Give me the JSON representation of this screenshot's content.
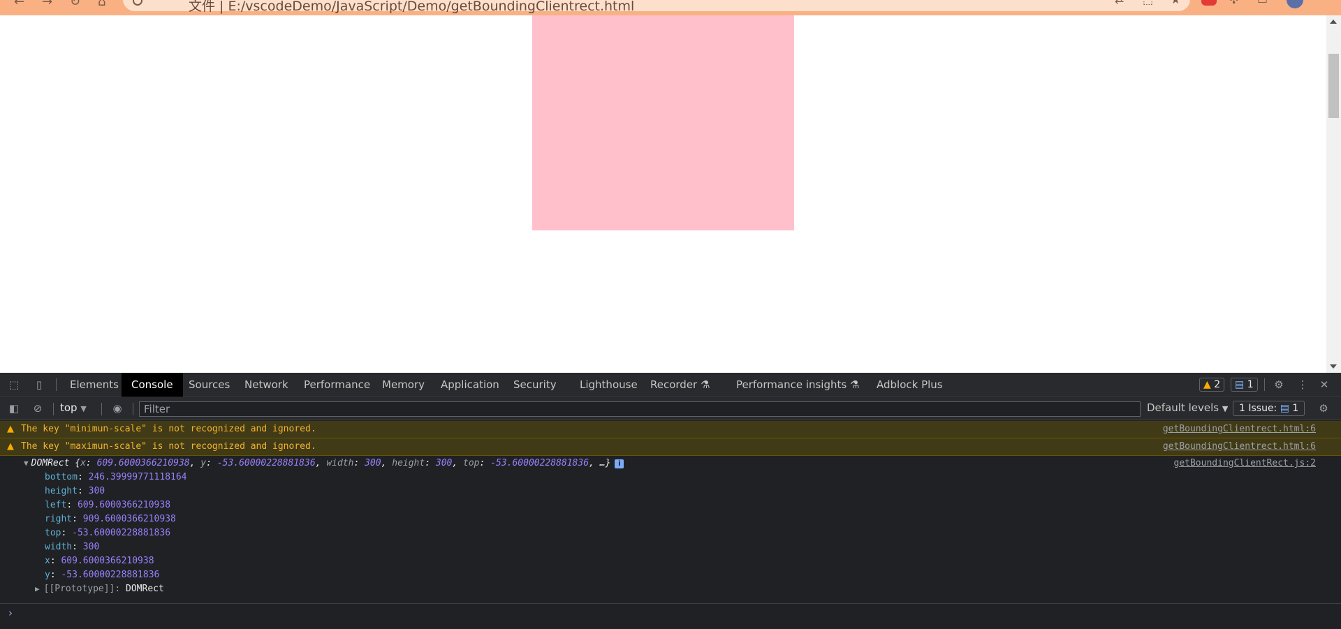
{
  "browser": {
    "url": "文件 | E:/vscodeDemo/JavaScript/Demo/getBoundingClientrect.html"
  },
  "page": {
    "box_color": "#ffc0cb"
  },
  "devtools": {
    "tabs": [
      "Elements",
      "Console",
      "Sources",
      "Network",
      "Performance",
      "Memory",
      "Application",
      "Security",
      "Lighthouse",
      "Recorder",
      "Performance insights",
      "Adblock Plus"
    ],
    "active_tab": "Console",
    "warn_count": "2",
    "msg_count": "1",
    "toolbar": {
      "context": "top",
      "filter_placeholder": "Filter",
      "levels": "Default levels",
      "issues_label": "1 Issue:",
      "issues_count": "1"
    },
    "console": {
      "warnings": [
        {
          "text": "The key \"minimun-scale\" is not recognized and ignored.",
          "source": "getBoundingClientrect.html:6"
        },
        {
          "text": "The key \"maximun-scale\" is not recognized and ignored.",
          "source": "getBoundingClientrect.html:6"
        }
      ],
      "log": {
        "source": "getBoundingClientRect.js:2",
        "class_name": "DOMRect",
        "summary": {
          "x": "609.6000366210938",
          "y": "-53.60000228881836",
          "width": "300",
          "height": "300",
          "top": "-53.60000228881836"
        },
        "properties": [
          {
            "key": "bottom",
            "value": "246.39999771118164"
          },
          {
            "key": "height",
            "value": "300"
          },
          {
            "key": "left",
            "value": "609.6000366210938"
          },
          {
            "key": "right",
            "value": "909.6000366210938"
          },
          {
            "key": "top",
            "value": "-53.60000228881836"
          },
          {
            "key": "width",
            "value": "300"
          },
          {
            "key": "x",
            "value": "609.6000366210938"
          },
          {
            "key": "y",
            "value": "-53.60000228881836"
          }
        ],
        "prototype_label": "[[Prototype]]",
        "prototype_value": "DOMRect"
      }
    }
  }
}
